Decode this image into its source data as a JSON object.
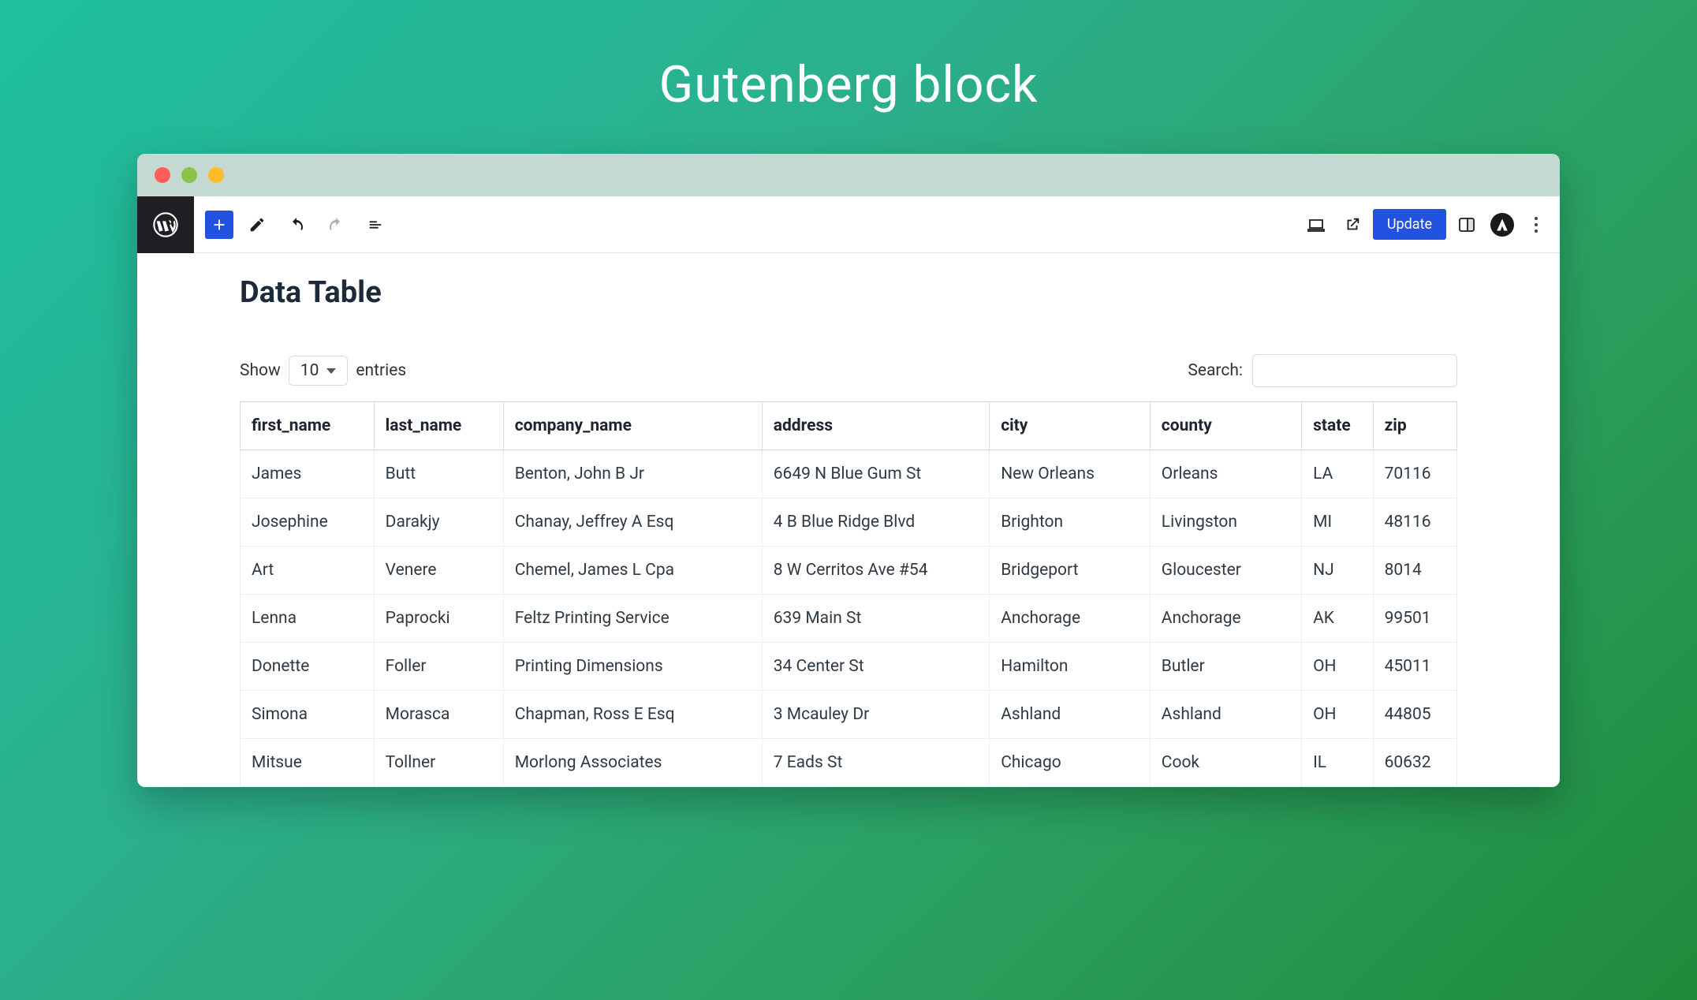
{
  "hero": {
    "title": "Gutenberg block"
  },
  "topbar": {
    "update_label": "Update"
  },
  "page": {
    "title": "Data Table",
    "show_label": "Show",
    "entries_label": "entries",
    "page_length": "10",
    "search_label": "Search:",
    "search_value": ""
  },
  "table": {
    "columns": [
      "first_name",
      "last_name",
      "company_name",
      "address",
      "city",
      "county",
      "state",
      "zip"
    ],
    "rows": [
      {
        "first_name": "James",
        "last_name": "Butt",
        "company_name": "Benton, John B Jr",
        "address": "6649 N Blue Gum St",
        "city": "New Orleans",
        "county": "Orleans",
        "state": "LA",
        "zip": "70116"
      },
      {
        "first_name": "Josephine",
        "last_name": "Darakjy",
        "company_name": "Chanay, Jeffrey A Esq",
        "address": "4 B Blue Ridge Blvd",
        "city": "Brighton",
        "county": "Livingston",
        "state": "MI",
        "zip": "48116"
      },
      {
        "first_name": "Art",
        "last_name": "Venere",
        "company_name": "Chemel, James L Cpa",
        "address": "8 W Cerritos Ave #54",
        "city": "Bridgeport",
        "county": "Gloucester",
        "state": "NJ",
        "zip": "8014"
      },
      {
        "first_name": "Lenna",
        "last_name": "Paprocki",
        "company_name": "Feltz Printing Service",
        "address": "639 Main St",
        "city": "Anchorage",
        "county": "Anchorage",
        "state": "AK",
        "zip": "99501"
      },
      {
        "first_name": "Donette",
        "last_name": "Foller",
        "company_name": "Printing Dimensions",
        "address": "34 Center St",
        "city": "Hamilton",
        "county": "Butler",
        "state": "OH",
        "zip": "45011"
      },
      {
        "first_name": "Simona",
        "last_name": "Morasca",
        "company_name": "Chapman, Ross E Esq",
        "address": "3 Mcauley Dr",
        "city": "Ashland",
        "county": "Ashland",
        "state": "OH",
        "zip": "44805"
      },
      {
        "first_name": "Mitsue",
        "last_name": "Tollner",
        "company_name": "Morlong Associates",
        "address": "7 Eads St",
        "city": "Chicago",
        "county": "Cook",
        "state": "IL",
        "zip": "60632"
      }
    ]
  }
}
